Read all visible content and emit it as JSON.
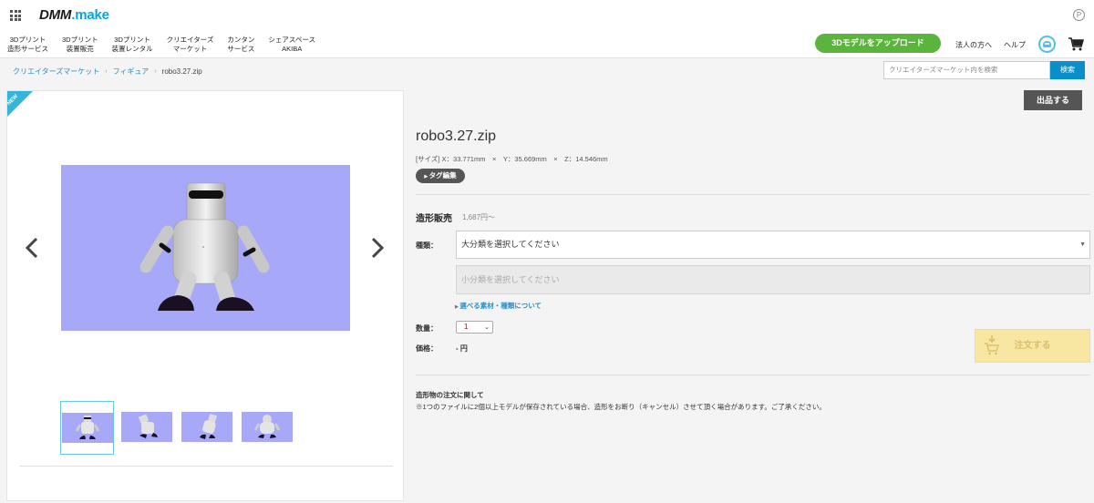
{
  "header": {
    "logo_main": "DMM",
    "logo_dot": ".",
    "logo_sub": "make",
    "point_icon": "P",
    "nav": [
      {
        "label": "3Dプリント\n造形サービス"
      },
      {
        "label": "3Dプリント\n装置販売"
      },
      {
        "label": "3Dプリント\n装置レンタル"
      },
      {
        "label": "クリエイターズ\nマーケット"
      },
      {
        "label": "カンタン\nサービス"
      },
      {
        "label": "シェアスペース\nAKIBA"
      }
    ],
    "upload_label": "3Dモデルをアップロード",
    "corporate_label": "法人の方へ",
    "help_label": "ヘルプ"
  },
  "breadcrumb": {
    "items": [
      "クリエイターズマーケット",
      "フィギュア"
    ],
    "current": "robo3.27.zip"
  },
  "search": {
    "placeholder": "クリエイターズマーケット内を検索",
    "button_label": "検索"
  },
  "gallery": {
    "badge": "NEW",
    "thumb_count": 4
  },
  "product": {
    "list_button": "出品する",
    "title": "robo3.27.zip",
    "size": "[サイズ] X：33.771mm　×　Y：35.669mm　×　Z：14.546mm",
    "tag_button": "タグ編集",
    "section_title": "造形販売",
    "price_from": "1,687円〜",
    "type_label": "種類：",
    "type_placeholder": "大分類を選択してください",
    "subtype_placeholder": "小分類を選択してください",
    "material_link": "選べる素材・種類について",
    "qty_label": "数量：",
    "qty_value": "1",
    "price_label": "価格：",
    "price_value": "- 円",
    "order_button": "注文する",
    "note_title": "造形物の注文に関して",
    "note_text": "※1つのファイルに2個以上モデルが保存されている場合、造形をお断り（キャンセル）させて頂く場合があります。ご了承ください。"
  },
  "colors": {
    "accent_green": "#5bb53c",
    "link_blue": "#2a8fc4",
    "search_blue": "#0a8ec9",
    "image_bg": "#a8a8f8",
    "order_disabled": "#f8e7a3"
  }
}
